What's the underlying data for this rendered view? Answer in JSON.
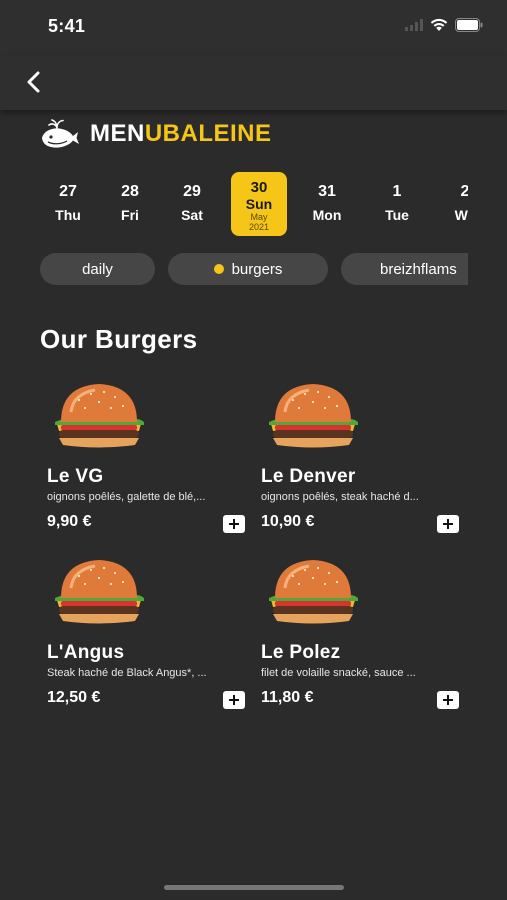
{
  "status": {
    "time": "5:41"
  },
  "nav": {
    "back_icon": "chevron-left-icon"
  },
  "brand": {
    "logo_icon": "whale-icon",
    "text_a": "MEN",
    "text_b": "UBALEINE",
    "accent": "#f5c518"
  },
  "days": [
    {
      "num": "27",
      "wd": "Thu"
    },
    {
      "num": "28",
      "wd": "Fri"
    },
    {
      "num": "29",
      "wd": "Sat"
    },
    {
      "num": "30",
      "wd": "Sun",
      "month": "May",
      "year": "2021",
      "selected": true
    },
    {
      "num": "31",
      "wd": "Mon"
    },
    {
      "num": "1",
      "wd": "Tue"
    },
    {
      "num": "2",
      "wd": "We"
    }
  ],
  "categories": [
    {
      "label": "daily"
    },
    {
      "label": "burgers",
      "active": true
    },
    {
      "label": "breizhflams"
    }
  ],
  "section": {
    "title": "Our Burgers"
  },
  "items": [
    {
      "name": "Le VG",
      "desc": "oignons poêlés, galette de blé,...",
      "price": "9,90",
      "currency": "€"
    },
    {
      "name": "Le Denver",
      "desc": "oignons poêlés, steak haché d...",
      "price": "10,90",
      "currency": "€"
    },
    {
      "name": "L'Angus",
      "desc": "Steak haché de Black Angus*, ...",
      "price": "12,50",
      "currency": "€"
    },
    {
      "name": "Le Polez",
      "desc": " filet de volaille snacké, sauce ...",
      "price": "11,80",
      "currency": "€"
    }
  ]
}
